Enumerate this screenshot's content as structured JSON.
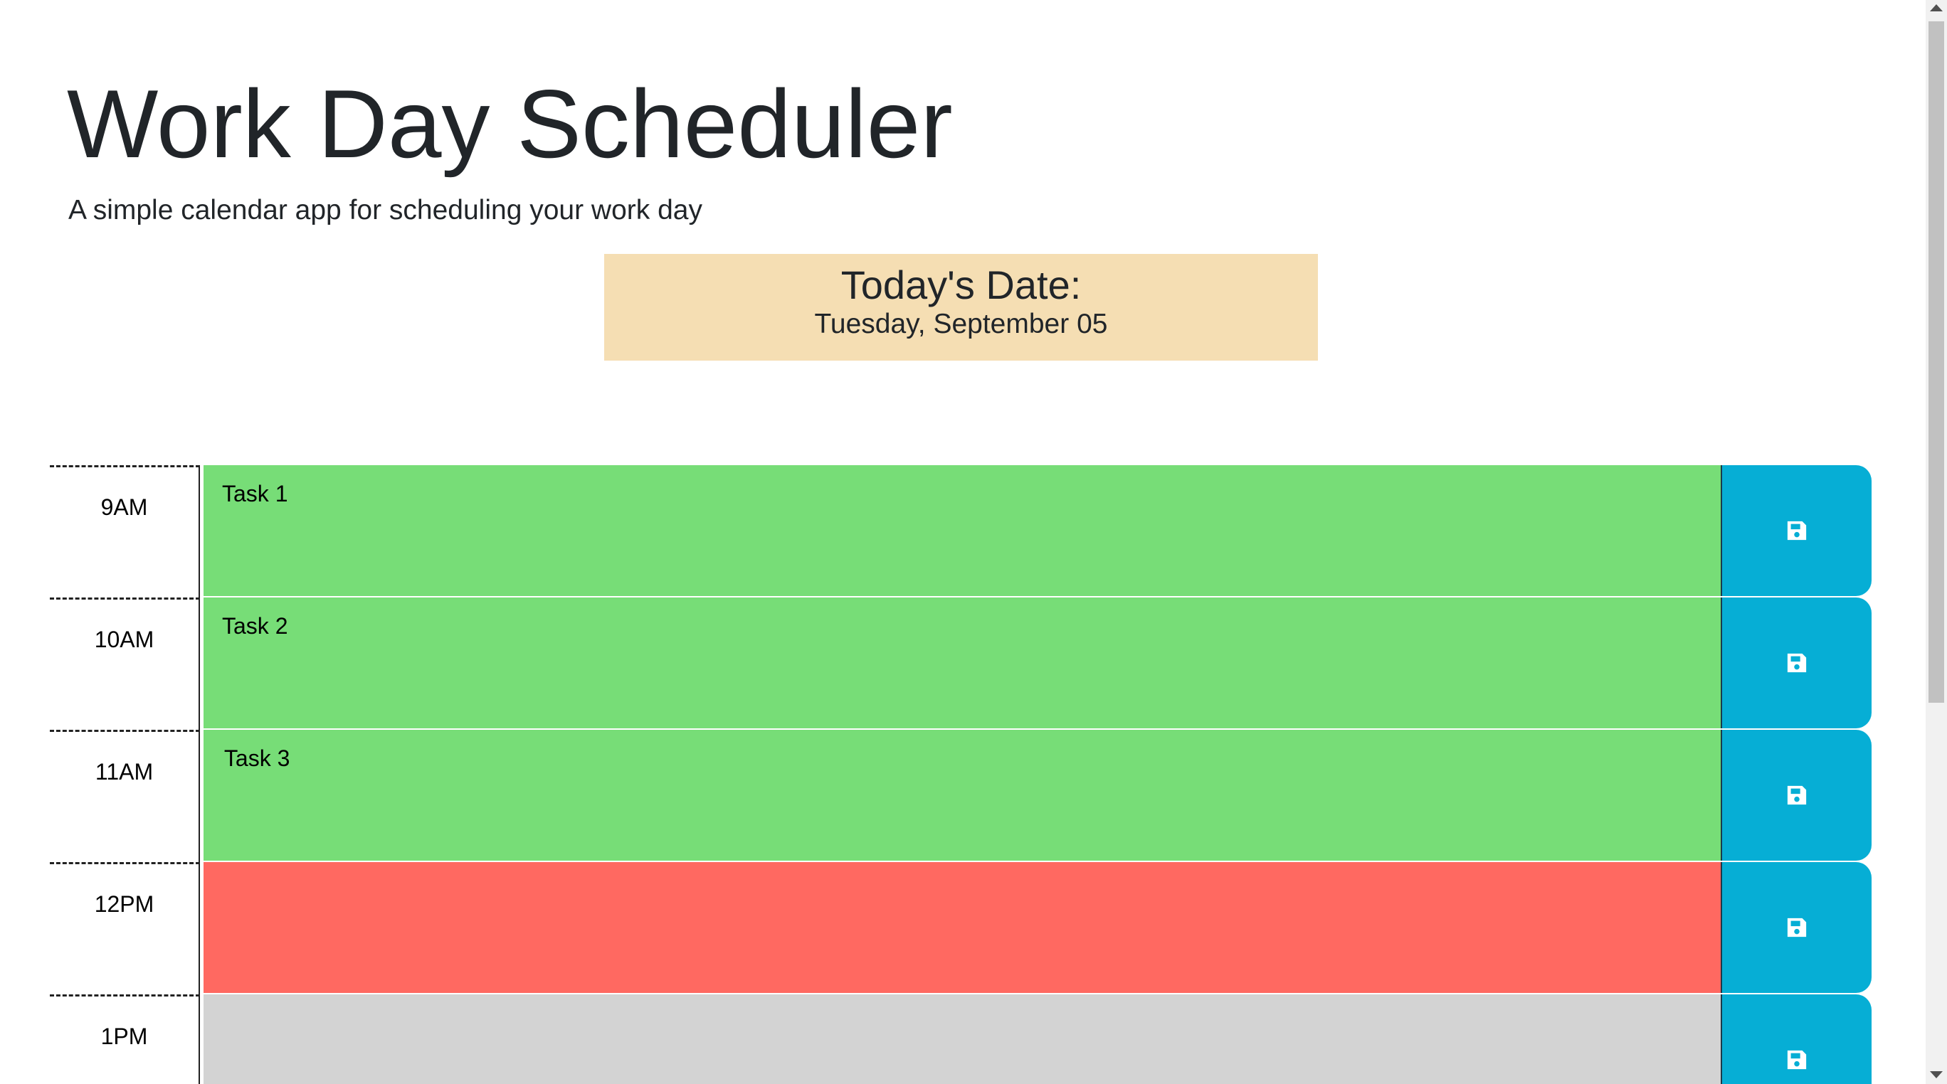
{
  "header": {
    "title": "Work Day Scheduler",
    "subtitle": "A simple calendar app for scheduling your work day"
  },
  "date_box": {
    "heading": "Today's Date:",
    "value": "Tuesday, September 05"
  },
  "colors": {
    "future": "#77dd77",
    "present": "#ff6961",
    "past": "#d3d3d3",
    "save_button": "#06aed5",
    "date_box": "#f5deb3"
  },
  "schedule": [
    {
      "hour": "9AM",
      "task": "Task 1",
      "status": "future",
      "save_icon": "save-icon"
    },
    {
      "hour": "10AM",
      "task": "Task 2",
      "status": "future",
      "save_icon": "save-icon"
    },
    {
      "hour": "11AM",
      "task": " Task 3",
      "status": "future",
      "save_icon": "save-icon"
    },
    {
      "hour": "12PM",
      "task": "",
      "status": "present",
      "save_icon": "save-icon"
    },
    {
      "hour": "1PM",
      "task": "",
      "status": "past",
      "save_icon": "save-icon"
    }
  ]
}
